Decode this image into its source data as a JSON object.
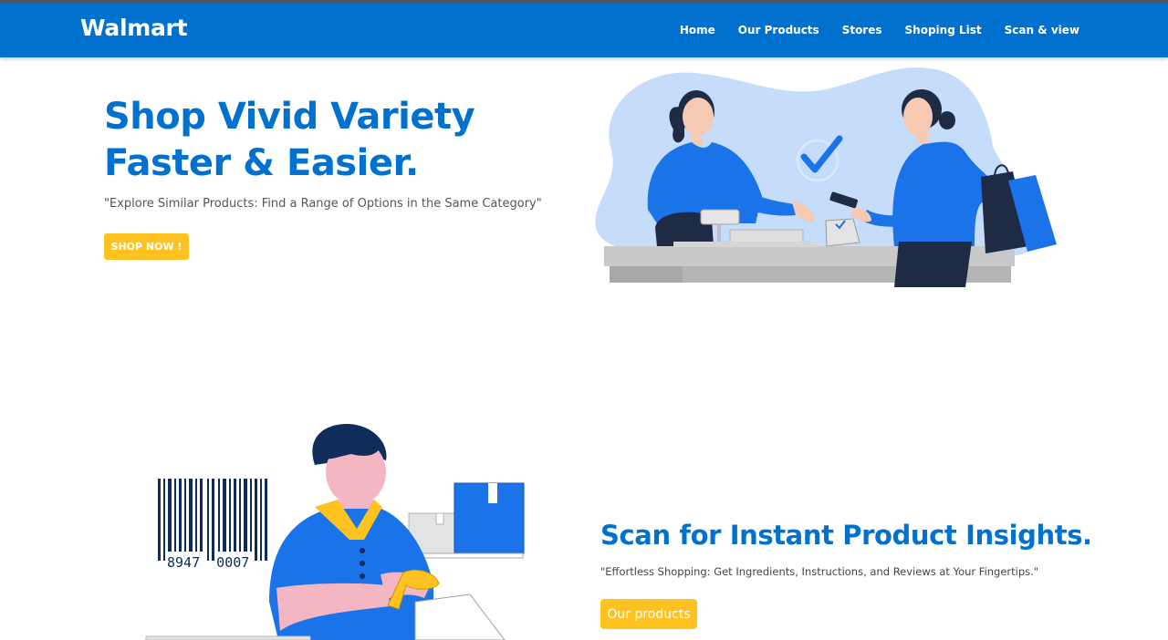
{
  "navbar": {
    "brand": "Walmart",
    "links": [
      "Home",
      "Our Products",
      "Stores",
      "Shoping List",
      "Scan & view"
    ]
  },
  "hero": {
    "title_line1": "Shop Vivid Variety",
    "title_line2": "Faster & Easier.",
    "subtitle": "\"Explore Similar Products: Find a Range of Options in the Same Category\"",
    "cta_label": "SHOP NOW !"
  },
  "scan_section": {
    "title": "Scan for Instant Product Insights.",
    "subtitle": "\"Effortless Shopping: Get Ingredients, Instructions, and Reviews at Your Fingertips.\"",
    "cta_label": "Our products",
    "barcode_digits": "8947  0007"
  },
  "icons": {
    "checkout_illustration": "checkout-illustration",
    "scanner_illustration": "scanner-illustration"
  },
  "colors": {
    "brand_blue": "#0071ce",
    "accent_yellow": "#ffc220",
    "illustration_blob": "#c5dcfa",
    "illustration_blue": "#1a73e8"
  }
}
